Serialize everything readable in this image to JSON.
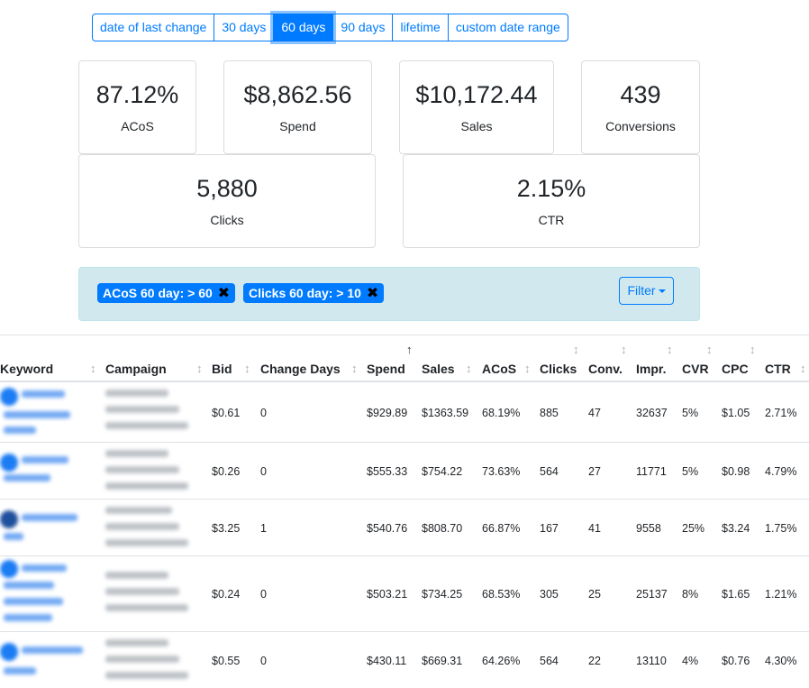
{
  "date_range": {
    "options": [
      "date of last change",
      "30 days",
      "60 days",
      "90 days",
      "lifetime",
      "custom date range"
    ],
    "selected": "60 days"
  },
  "stats": {
    "acos": {
      "value": "87.12%",
      "label": "ACoS"
    },
    "spend": {
      "value": "$8,862.56",
      "label": "Spend"
    },
    "sales": {
      "value": "$10,172.44",
      "label": "Sales"
    },
    "conversions": {
      "value": "439",
      "label": "Conversions"
    },
    "clicks": {
      "value": "5,880",
      "label": "Clicks"
    },
    "ctr": {
      "value": "2.15%",
      "label": "CTR"
    }
  },
  "filters": {
    "chips": [
      {
        "label": "ACoS 60 day: > 60",
        "remove_icon": "close-icon"
      },
      {
        "label": "Clicks 60 day: > 10",
        "remove_icon": "close-icon"
      }
    ],
    "button_label": "Filter"
  },
  "table": {
    "headers": [
      "Keyword",
      "Campaign",
      "Bid",
      "Change Days",
      "Spend",
      "Sales",
      "ACoS",
      "Clicks",
      "Conv.",
      "Impr.",
      "CVR",
      "CPC",
      "CTR"
    ],
    "sorted_column": "Spend",
    "rows": [
      {
        "bid": "$0.61",
        "change_days": "0",
        "spend": "$929.89",
        "sales": "$1363.59",
        "acos": "68.19%",
        "clicks": "885",
        "conv": "47",
        "impr": "32637",
        "cvr": "5%",
        "cpc": "$1.05",
        "ctr": "2.71%"
      },
      {
        "bid": "$0.26",
        "change_days": "0",
        "spend": "$555.33",
        "sales": "$754.22",
        "acos": "73.63%",
        "clicks": "564",
        "conv": "27",
        "impr": "11771",
        "cvr": "5%",
        "cpc": "$0.98",
        "ctr": "4.79%"
      },
      {
        "bid": "$3.25",
        "change_days": "1",
        "spend": "$540.76",
        "sales": "$808.70",
        "acos": "66.87%",
        "clicks": "167",
        "conv": "41",
        "impr": "9558",
        "cvr": "25%",
        "cpc": "$3.24",
        "ctr": "1.75%"
      },
      {
        "bid": "$0.24",
        "change_days": "0",
        "spend": "$503.21",
        "sales": "$734.25",
        "acos": "68.53%",
        "clicks": "305",
        "conv": "25",
        "impr": "25137",
        "cvr": "8%",
        "cpc": "$1.65",
        "ctr": "1.21%"
      },
      {
        "bid": "$0.55",
        "change_days": "0",
        "spend": "$430.11",
        "sales": "$669.31",
        "acos": "64.26%",
        "clicks": "564",
        "conv": "22",
        "impr": "13110",
        "cvr": "4%",
        "cpc": "$0.76",
        "ctr": "4.30%"
      }
    ]
  },
  "colors": {
    "primary": "#007bff",
    "filter_bg": "#d1e9ee",
    "border": "#dee2e6"
  }
}
